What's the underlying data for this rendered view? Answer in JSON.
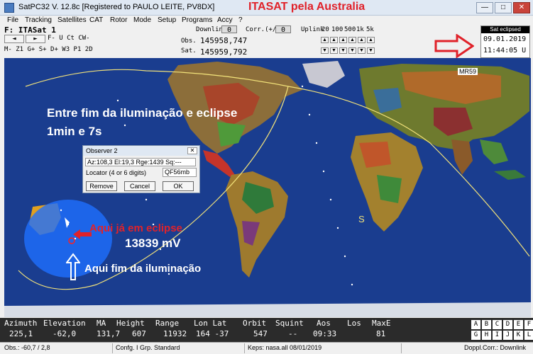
{
  "window": {
    "title": "SatPC32 V. 12.8c   [Registered to PAULO LEITE, PV8DX]",
    "annotation_title": "ITASAT pela Australia",
    "minimize": "—",
    "maximize": "□",
    "close": "✕"
  },
  "menu": [
    "File",
    "Tracking",
    "Satellites",
    "CAT",
    "Rotor",
    "Mode",
    "Setup",
    "Programs",
    "Accy",
    "?"
  ],
  "toolbar": {
    "satellite": "F: ITASat 1",
    "nav_prev": "◄",
    "nav_next": "►",
    "row1_labels": "F- U Ct CW-",
    "row2_labels": "M- Z1 G+ S+ D+ W3 P1 2D",
    "downlink_label": "Downlink",
    "downlink_value": "0",
    "corr_label": "Corr.(+/-)",
    "corr_value": "0",
    "uplink_label": "Uplink",
    "steps": [
      "20",
      "100",
      "500",
      "1k",
      "5k"
    ],
    "obs_label": "Obs.",
    "sat_label": "Sat.",
    "obs_freq": "145958,747",
    "sat_freq": "145959,792",
    "spin_up": "▲",
    "spin_down": "▼"
  },
  "clock": {
    "badge": "Sat eclipsed",
    "date": "09.01.2019",
    "time": "11:44:05 U"
  },
  "map": {
    "sat_label": "MR59",
    "sun_marker": "S",
    "colors": {
      "ocean": "#1a3d8f",
      "footprint": "#1e6fff",
      "track": "#f2e27a"
    }
  },
  "dialog": {
    "title": "Observer 2",
    "close": "✕",
    "readout": "Az:108,3  El:19,3  Rge:1439  Sq:---",
    "locator_label": "Locator (4 or 6 digits)",
    "locator_value": "QF56mb",
    "remove": "Remove",
    "cancel": "Cancel",
    "ok": "OK"
  },
  "annotations": {
    "eclipse_note_1": "Entre fim da iluminação e eclipse",
    "eclipse_note_2": "1min e 7s",
    "already_eclipse": "Aqui já em eclipse",
    "voltage": "13839 mV",
    "end_illumination": "Aqui fim da iluminação"
  },
  "data_table": {
    "headers": [
      "Azimuth",
      "Elevation",
      "MA",
      "Height",
      "Range",
      "Lon Lat",
      "Orbit",
      "Squint",
      "Aos",
      "Los",
      "MaxE"
    ],
    "values": [
      "225,1",
      "-62,0",
      "131,7",
      "607",
      "11932",
      "164 -37",
      "547",
      "--",
      "09:33",
      "",
      "81"
    ]
  },
  "letters": [
    "A",
    "B",
    "C",
    "D",
    "E",
    "F",
    "G",
    "H",
    "I",
    "J",
    "K",
    "L"
  ],
  "status": {
    "obs": "Obs.: -60,7 / 2,8",
    "config": "Confg. I  Grp. Standard",
    "keps": "Keps: nasa.all 08/01/2019",
    "doppl": "Doppl.Corr.: Downlink"
  }
}
